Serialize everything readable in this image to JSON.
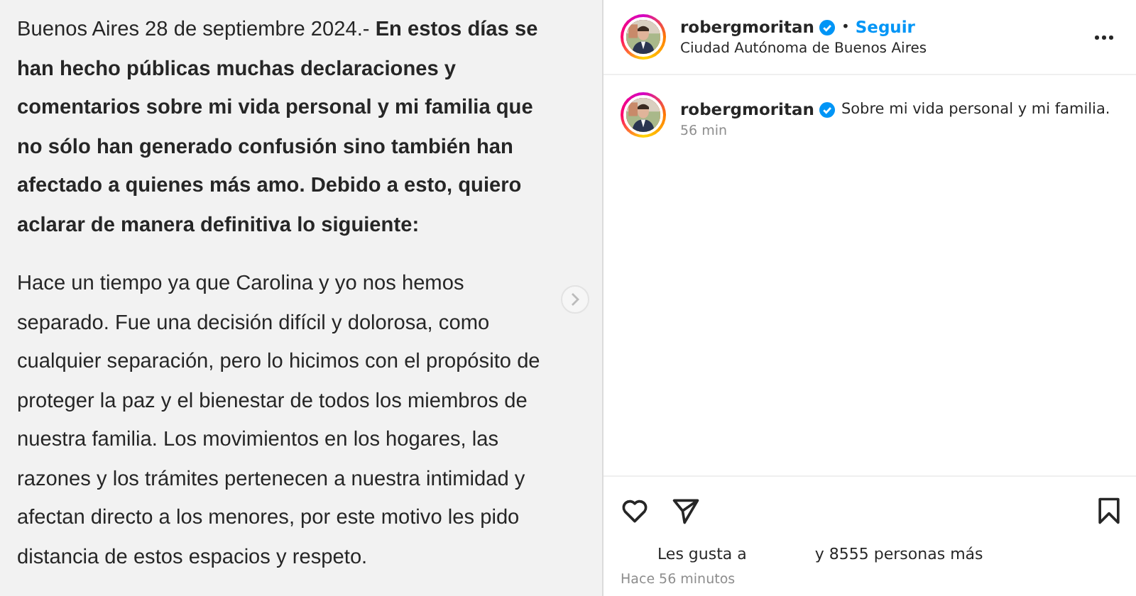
{
  "post_text": {
    "paragraphs": [
      "Buenos Aires 28 de septiembre 2024.- **En estos días se han hecho públicas muchas declaraciones y comentarios sobre mi vida personal y mi familia que no sólo han generado confusión sino también han afectado a quienes más amo. Debido a esto, quiero aclarar de manera definitiva lo siguiente:**",
      "Hace un tiempo ya que Carolina y yo nos hemos separado. Fue una decisión difícil y dolorosa, como cualquier separación, pero lo hicimos con el propósito de proteger la paz y el bienestar de todos los miembros de nuestra familia. Los movimientos en los hogares, las razones y los trámites pertenecen a nuestra intimidad y afectan directo a los menores, por este motivo les pido distancia de estos espacios y respeto."
    ]
  },
  "header": {
    "username": "robergmoritan",
    "verified": true,
    "separator": "•",
    "follow": "Seguir",
    "location": "Ciudad Autónoma de Buenos Aires"
  },
  "caption": {
    "username": "robergmoritan",
    "verified": true,
    "text": "Sobre mi vida personal y mi familia.",
    "time": "56 min"
  },
  "likes": {
    "prefix": "Les gusta a",
    "suffix": "y 8555 personas más"
  },
  "timestamp": "Hace 56 minutos"
}
